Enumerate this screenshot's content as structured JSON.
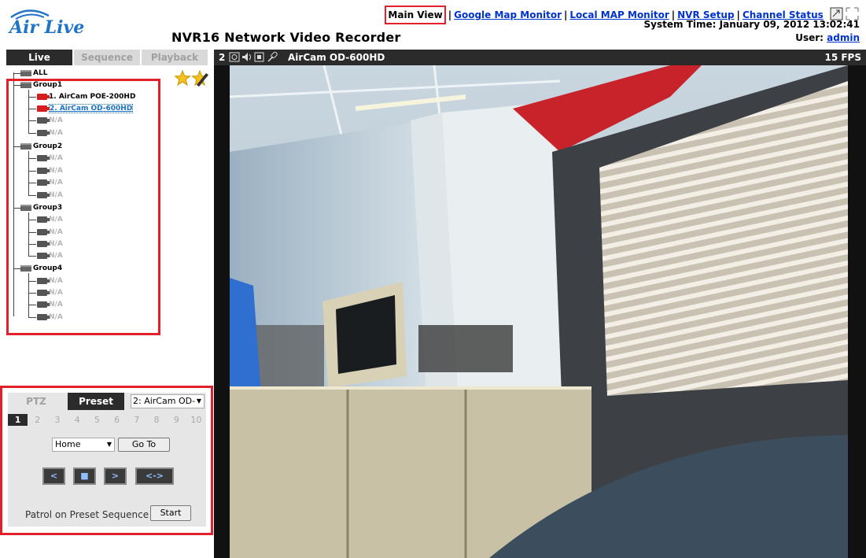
{
  "header": {
    "logo_text": "Air Live",
    "title": "NVR16 Network Video Recorder",
    "nav": [
      "Main View",
      "Google Map Monitor",
      "Local MAP Monitor",
      "NVR Setup",
      "Channel Status"
    ],
    "system_time_label": "System Time:",
    "system_time": "January 09, 2012 13:02:41",
    "user_label": "User:",
    "user": "admin"
  },
  "left_tabs": [
    "Live",
    "Sequence",
    "Playback"
  ],
  "tree": {
    "all_label": "ALL",
    "groups": [
      {
        "label": "Group1",
        "cams": [
          "1. AirCam POE-200HD",
          "2. AirCam OD-600HD",
          "N/A",
          "N/A"
        ]
      },
      {
        "label": "Group2",
        "cams": [
          "N/A",
          "N/A",
          "N/A",
          "N/A"
        ]
      },
      {
        "label": "Group3",
        "cams": [
          "N/A",
          "N/A",
          "N/A",
          "N/A"
        ]
      },
      {
        "label": "Group4",
        "cams": [
          "N/A",
          "N/A",
          "N/A",
          "N/A"
        ]
      }
    ]
  },
  "ptz": {
    "tabs": [
      "PTZ",
      "Preset"
    ],
    "camera_select": "2: AirCam OD-",
    "numbers": [
      "1",
      "2",
      "3",
      "4",
      "5",
      "6",
      "7",
      "8",
      "9",
      "10"
    ],
    "preset_select": "Home",
    "goto_label": "Go To",
    "controls": [
      "<",
      "■",
      ">",
      "<->"
    ],
    "patrol_label": "Patrol on Preset Sequence",
    "start_label": "Start"
  },
  "video": {
    "channel": "2",
    "camera_name": "AirCam OD-600HD",
    "fps": "15 FPS"
  },
  "colors": {
    "highlight_red": "#e0202a",
    "dark_bar": "#2b2b2b",
    "link_blue": "#0033cc"
  }
}
